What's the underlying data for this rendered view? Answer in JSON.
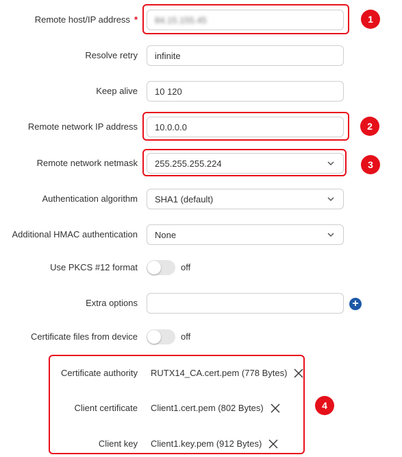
{
  "fields": {
    "remote_host": {
      "label": "Remote host/IP address",
      "required_mark": "*",
      "value": "84.15.155.45"
    },
    "resolve_retry": {
      "label": "Resolve retry",
      "value": "infinite"
    },
    "keep_alive": {
      "label": "Keep alive",
      "value": "10 120"
    },
    "remote_network_ip": {
      "label": "Remote network IP address",
      "value": "10.0.0.0"
    },
    "remote_network_netmask": {
      "label": "Remote network netmask",
      "value": "255.255.255.224"
    },
    "auth_algorithm": {
      "label": "Authentication algorithm",
      "value": "SHA1 (default)"
    },
    "hmac_auth": {
      "label": "Additional HMAC authentication",
      "value": "None"
    },
    "pkcs12": {
      "label": "Use PKCS #12 format",
      "state": "off"
    },
    "extra_options": {
      "label": "Extra options",
      "value": ""
    },
    "cert_from_device": {
      "label": "Certificate files from device",
      "state": "off"
    }
  },
  "certificates": {
    "ca": {
      "label": "Certificate authority",
      "file": "RUTX14_CA.cert.pem (778 Bytes)"
    },
    "client_cert": {
      "label": "Client certificate",
      "file": "Client1.cert.pem (802 Bytes)"
    },
    "client_key": {
      "label": "Client key",
      "file": "Client1.key.pem (912 Bytes)"
    }
  },
  "badges": [
    "1",
    "2",
    "3",
    "4"
  ],
  "colors": {
    "highlight": "#e8101a",
    "badge": "#e5101a",
    "add_button": "#1d58a6"
  },
  "icons": {
    "add": "plus-circle-icon",
    "remove": "x-icon",
    "dropdown": "chevron-down-icon"
  }
}
